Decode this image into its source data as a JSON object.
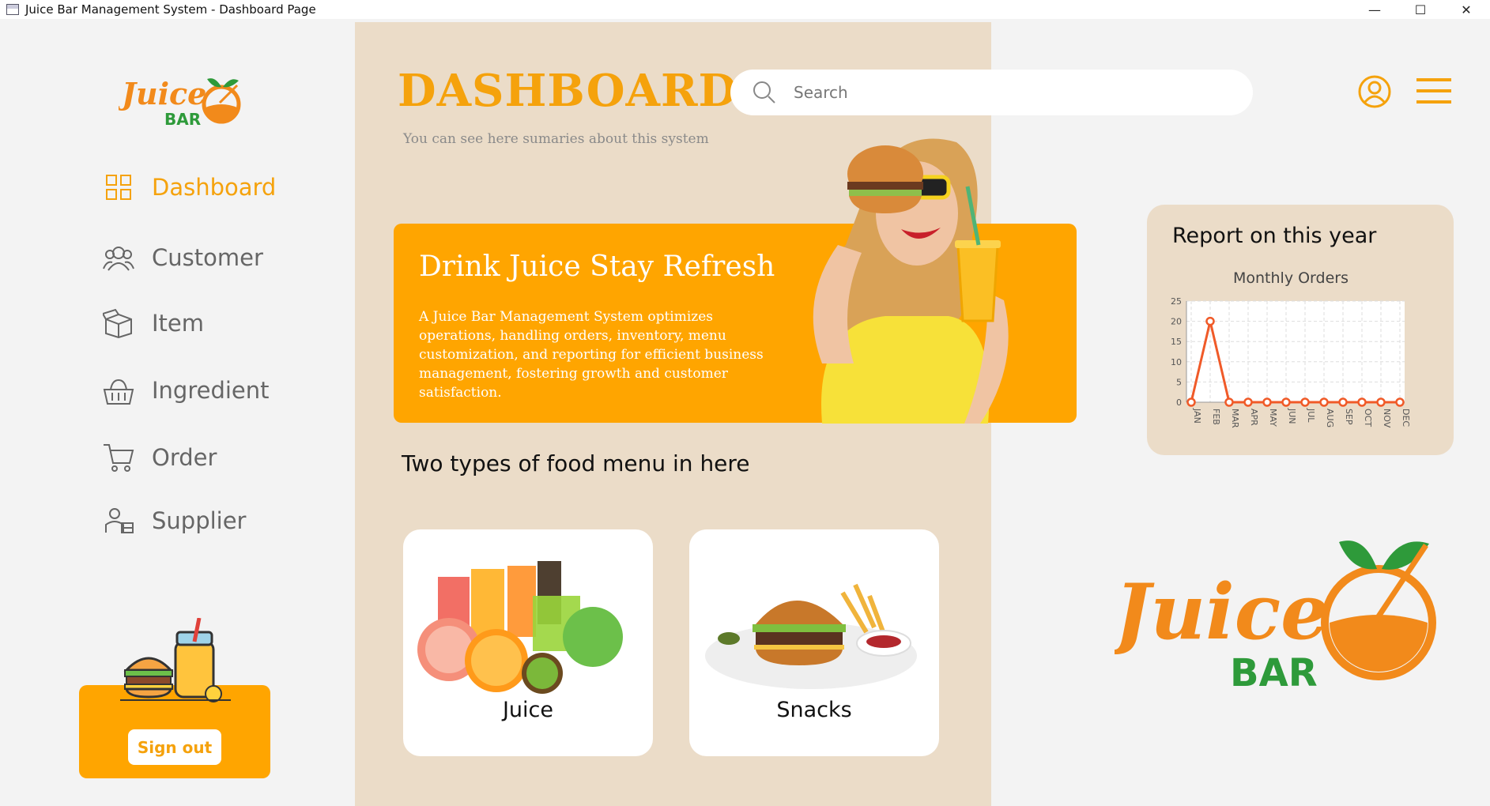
{
  "window": {
    "title": "Juice Bar Management System - Dashboard Page",
    "minimize": "—",
    "maximize": "☐",
    "close": "✕"
  },
  "brand": {
    "logo_word": "Juice",
    "logo_sub": "BAR"
  },
  "sidebar": {
    "items": [
      {
        "label": "Dashboard",
        "icon": "grid-icon",
        "active": true
      },
      {
        "label": "Customer",
        "icon": "users-icon",
        "active": false
      },
      {
        "label": "Item",
        "icon": "box-icon",
        "active": false
      },
      {
        "label": "Ingredient",
        "icon": "basket-icon",
        "active": false
      },
      {
        "label": "Order",
        "icon": "cart-icon",
        "active": false
      },
      {
        "label": "Supplier",
        "icon": "supplier-icon",
        "active": false
      }
    ],
    "signout_label": "Sign out"
  },
  "header": {
    "title": "DASHBOARD",
    "subtitle": "You can see here sumaries about this system",
    "search_placeholder": "Search"
  },
  "banner": {
    "title": "Drink Juice Stay Refresh",
    "text": "A Juice Bar Management System optimizes operations, handling orders, inventory, menu customization, and reporting for efficient business management, fostering growth and customer satisfaction."
  },
  "menu": {
    "heading": "Two types of food menu in here",
    "cards": [
      {
        "label": "Juice"
      },
      {
        "label": "Snacks"
      }
    ]
  },
  "report": {
    "title": "Report on this year"
  },
  "colors": {
    "accent": "#ffa500",
    "panel": "#ebdcc8",
    "line": "#f05a28"
  },
  "chart_data": {
    "type": "line",
    "title": "Monthly Orders",
    "categories": [
      "JAN",
      "FEB",
      "MAR",
      "APR",
      "MAY",
      "JUN",
      "JUL",
      "AUG",
      "SEP",
      "OCT",
      "NOV",
      "DEC"
    ],
    "series": [
      {
        "values": [
          0,
          20,
          0,
          0,
          0,
          0,
          0,
          0,
          0,
          0,
          0,
          0
        ]
      }
    ],
    "yticks": [
      0,
      5,
      10,
      15,
      20,
      25
    ],
    "ylim": [
      0,
      25
    ],
    "grid": true
  }
}
